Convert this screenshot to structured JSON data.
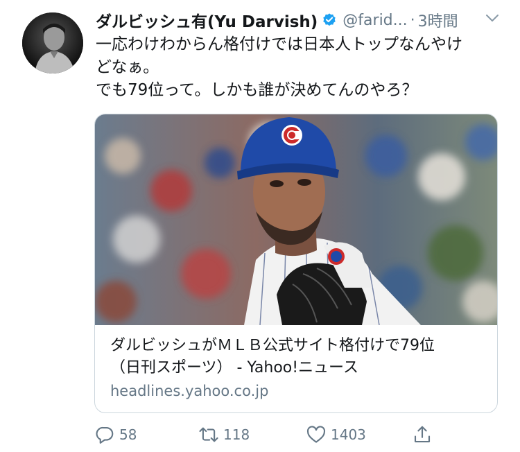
{
  "tweet": {
    "author_name": "ダルビッシュ有(Yu Darvish)",
    "handle": "@farid...",
    "separator": "·",
    "time": "3時間",
    "lines": [
      "一応わけわからん格付けでは日本人トップなんやけ",
      "どなぁ。",
      "でも79位って。しかも誰が決めてんのやろ？"
    ]
  },
  "card": {
    "title_line1": "ダルビッシュがＭＬＢ公式サイト格付けで79位",
    "title_line2": "（日刊スポーツ） - Yahoo!ニュース",
    "url": "headlines.yahoo.co.jp"
  },
  "actions": {
    "reply_count": "58",
    "retweet_count": "118",
    "like_count": "1403"
  },
  "icons": {
    "verified": "verified-badge-icon",
    "more": "chevron-down-icon",
    "reply": "reply-icon",
    "retweet": "retweet-icon",
    "like": "heart-icon",
    "share": "share-icon"
  },
  "colors": {
    "verified": "#1da1f2",
    "secondary_text": "#657786",
    "card_border": "#ccd6dd"
  }
}
